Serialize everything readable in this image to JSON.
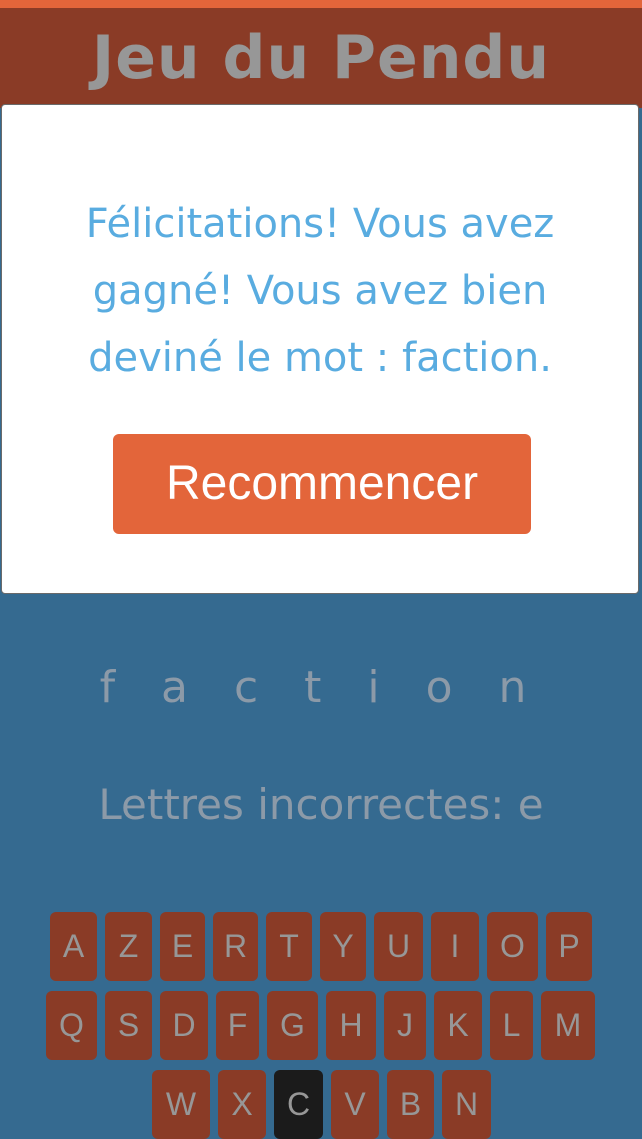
{
  "header": {
    "title": "Jeu du Pendu"
  },
  "modal": {
    "message": "Félicitations! Vous avez gagné! Vous avez bien deviné le mot : faction.",
    "restart_label": "Recommencer"
  },
  "game": {
    "word_display": "f a c t i o n",
    "wrong_letters_label": "Lettres incorrectes: e"
  },
  "keyboard": {
    "row1": [
      "A",
      "Z",
      "E",
      "R",
      "T",
      "Y",
      "U",
      "I",
      "O",
      "P"
    ],
    "row2": [
      "Q",
      "S",
      "D",
      "F",
      "G",
      "H",
      "J",
      "K",
      "L",
      "M"
    ],
    "row3": [
      "W",
      "X",
      "C",
      "V",
      "B",
      "N"
    ],
    "used_keys": [
      "C"
    ]
  },
  "colors": {
    "accent": "#e3653a",
    "header_bg": "#8a3b26",
    "page_bg": "#356a90",
    "message_text": "#59ace0",
    "key_bg": "#8a3b26",
    "key_used_bg": "#1b1b1b"
  }
}
